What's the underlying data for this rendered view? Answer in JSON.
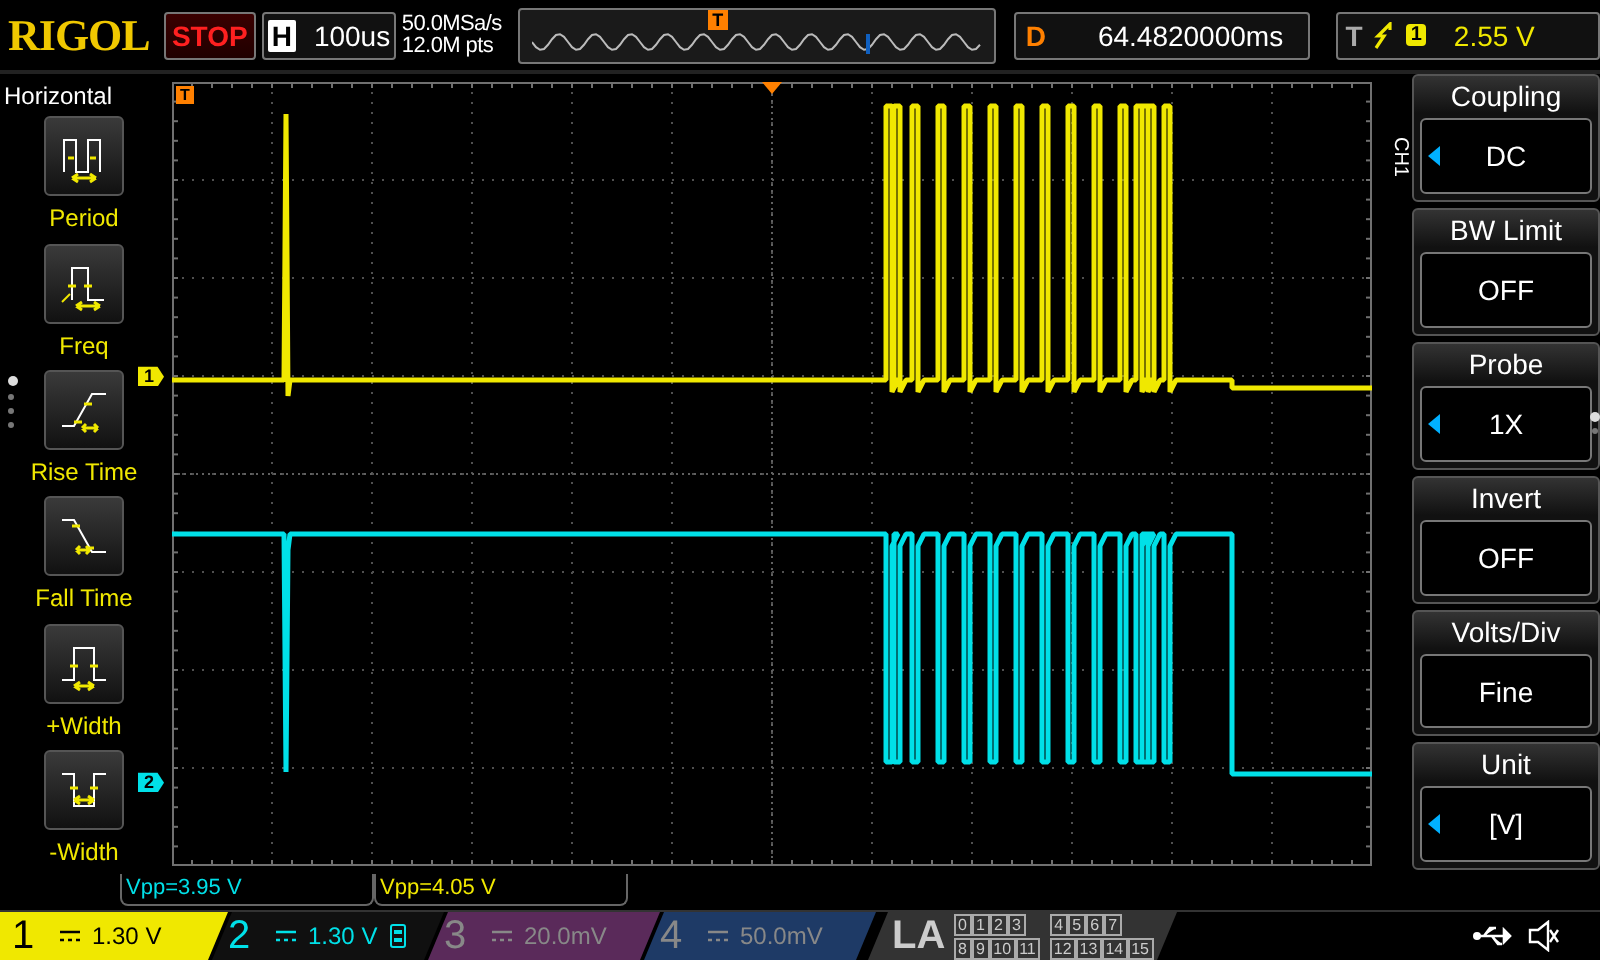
{
  "top_bar": {
    "brand": "RIGOL",
    "run_state": "STOP",
    "horizontal": {
      "label": "H",
      "timebase": "100us"
    },
    "sample_rate": "50.0MSa/s",
    "memory_depth": "12.0M pts",
    "trigger_position": "T",
    "delay": {
      "label": "D",
      "value": "64.4820000ms"
    },
    "trigger": {
      "label": "T",
      "channel": "1",
      "level": "2.55 V"
    }
  },
  "left_menu": {
    "title": "Horizontal",
    "items": [
      {
        "label": "Period",
        "kind": "period"
      },
      {
        "label": "Freq",
        "kind": "freq"
      },
      {
        "label": "Rise Time",
        "kind": "rise"
      },
      {
        "label": "Fall Time",
        "kind": "fall"
      },
      {
        "label": "+Width",
        "kind": "pwidth"
      },
      {
        "label": "-Width",
        "kind": "nwidth"
      }
    ]
  },
  "screen": {
    "trigger_marker": "T",
    "channel_label": "CH1",
    "channel_markers": [
      {
        "label": "1",
        "color": "#f0e800"
      },
      {
        "label": "2",
        "color": "#00e0e8"
      }
    ]
  },
  "right_menu": {
    "items": [
      {
        "title": "Coupling",
        "value": "DC",
        "adjustable": true
      },
      {
        "title": "BW Limit",
        "value": "OFF",
        "adjustable": false
      },
      {
        "title": "Probe",
        "value": "1X",
        "adjustable": true
      },
      {
        "title": "Invert",
        "value": "OFF",
        "adjustable": false
      },
      {
        "title": "Volts/Div",
        "value": "Fine",
        "adjustable": false
      },
      {
        "title": "Unit",
        "value": "[V]",
        "adjustable": true
      }
    ]
  },
  "measurements": [
    {
      "text": "Vpp=3.95 V",
      "color": "#00e0e8"
    },
    {
      "text": "Vpp=4.05 V",
      "color": "#f0e800"
    }
  ],
  "channels": [
    {
      "number": "1",
      "scale": "1.30 V",
      "on": true,
      "selected": true,
      "bw_limit": false,
      "color": "#f0e800"
    },
    {
      "number": "2",
      "scale": "1.30 V",
      "on": true,
      "selected": false,
      "bw_limit": true,
      "color": "#00e0e8"
    },
    {
      "number": "3",
      "scale": "20.0mV",
      "on": false,
      "selected": false,
      "bw_limit": false,
      "color": "#5a2a5a"
    },
    {
      "number": "4",
      "scale": "50.0mV",
      "on": false,
      "selected": false,
      "bw_limit": false,
      "color": "#1e3a66"
    }
  ],
  "logic": {
    "label": "LA",
    "groups": [
      [
        "0",
        "1",
        "2",
        "3"
      ],
      [
        "4",
        "5",
        "6",
        "7"
      ],
      [
        "8",
        "9",
        "10",
        "11"
      ],
      [
        "12",
        "13",
        "14",
        "15"
      ]
    ]
  }
}
